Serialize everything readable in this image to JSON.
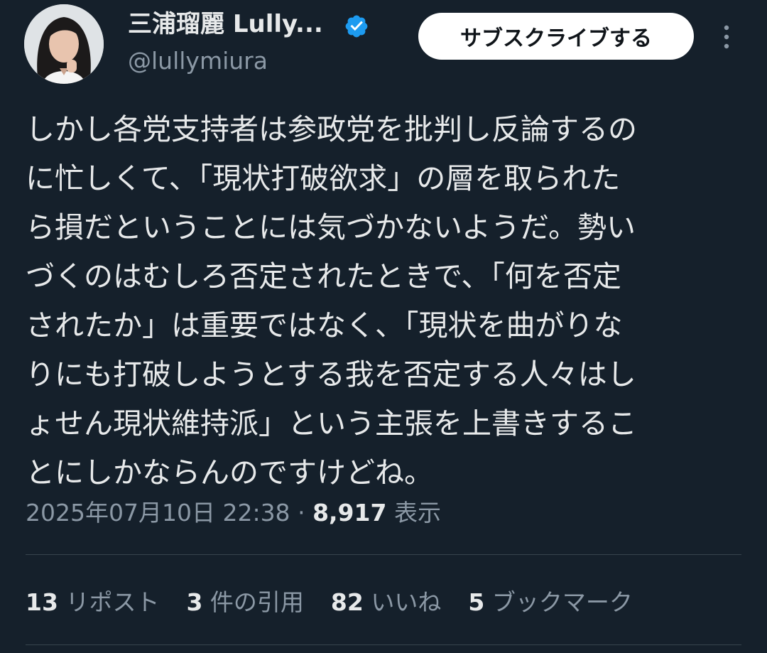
{
  "author": {
    "display_name": "三浦瑠麗 Lully...",
    "handle": "@lullymiura",
    "verified_icon": "verified-badge-icon",
    "avatar": "profile-photo"
  },
  "header": {
    "subscribe_label": "サブスクライブする",
    "more_icon": "more-options-icon"
  },
  "tweet": {
    "text": "しかし各党支持者は参政党を批判し反論するの\nに忙しくて、「現状打破欲求」の層を取られた\nら損だということには気づかないようだ。勢い\nづくのはむしろ否定されたときで、「何を否定\nされたか」は重要ではなく、「現状を曲がりな\nりにも打破しようとする我を否定する人々はし\nょせん現状維持派」という主張を上書きするこ\nとにしかならんのですけどね。",
    "timestamp": "2025年07月10日 22:38",
    "separator": "·",
    "views_count": "8,917",
    "views_label": "表示"
  },
  "stats": {
    "reposts": {
      "count": "13",
      "label": "リポスト"
    },
    "quotes": {
      "count": "3",
      "label": "件の引用"
    },
    "likes": {
      "count": "82",
      "label": "いいね"
    },
    "bookmarks": {
      "count": "5",
      "label": "ブックマーク"
    }
  },
  "colors": {
    "background": "#15202b",
    "text": "#e7e9ea",
    "secondary_text": "#8b98a5",
    "verified": "#1d9bf0",
    "divider": "#38444d"
  }
}
